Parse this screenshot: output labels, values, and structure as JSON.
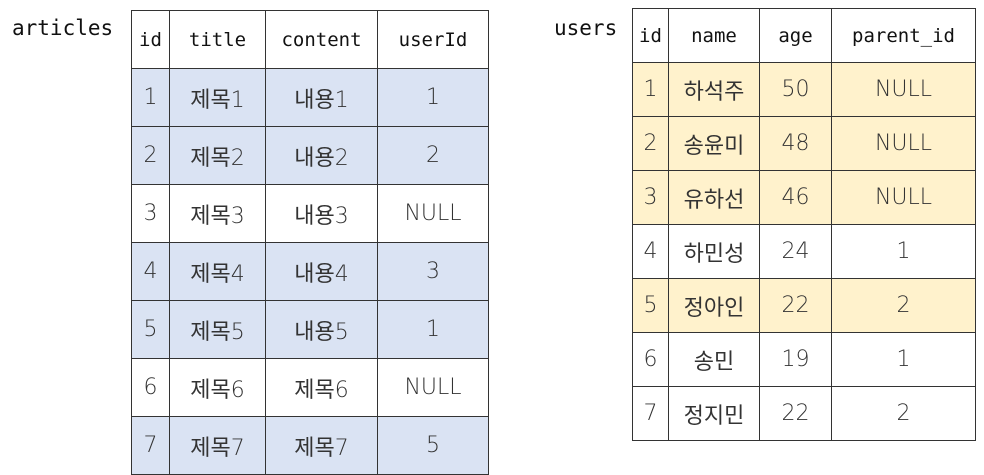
{
  "articles": {
    "label": "articles",
    "columns": [
      "id",
      "title",
      "content",
      "userId"
    ],
    "rows": [
      {
        "cells": [
          "1",
          "제목1",
          "내용1",
          "1"
        ],
        "highlight": "blue"
      },
      {
        "cells": [
          "2",
          "제목2",
          "내용2",
          "2"
        ],
        "highlight": "blue"
      },
      {
        "cells": [
          "3",
          "제목3",
          "내용3",
          "NULL"
        ],
        "highlight": "none"
      },
      {
        "cells": [
          "4",
          "제목4",
          "내용4",
          "3"
        ],
        "highlight": "blue"
      },
      {
        "cells": [
          "5",
          "제목5",
          "내용5",
          "1"
        ],
        "highlight": "blue"
      },
      {
        "cells": [
          "6",
          "제목6",
          "제목6",
          "NULL"
        ],
        "highlight": "none"
      },
      {
        "cells": [
          "7",
          "제목7",
          "제목7",
          "5"
        ],
        "highlight": "blue"
      }
    ]
  },
  "users": {
    "label": "users",
    "columns": [
      "id",
      "name",
      "age",
      "parent_id"
    ],
    "rows": [
      {
        "cells": [
          "1",
          "하석주",
          "50",
          "NULL"
        ],
        "highlight": "yellow"
      },
      {
        "cells": [
          "2",
          "송윤미",
          "48",
          "NULL"
        ],
        "highlight": "yellow"
      },
      {
        "cells": [
          "3",
          "유하선",
          "46",
          "NULL"
        ],
        "highlight": "yellow"
      },
      {
        "cells": [
          "4",
          "하민성",
          "24",
          "1"
        ],
        "highlight": "none"
      },
      {
        "cells": [
          "5",
          "정아인",
          "22",
          "2"
        ],
        "highlight": "yellow"
      },
      {
        "cells": [
          "6",
          "송민",
          "19",
          "1"
        ],
        "highlight": "none"
      },
      {
        "cells": [
          "7",
          "정지민",
          "22",
          "2"
        ],
        "highlight": "none"
      }
    ]
  },
  "colors": {
    "blue_highlight": "#dae3f3",
    "yellow_highlight": "#fff2cc",
    "border": "#333333"
  }
}
